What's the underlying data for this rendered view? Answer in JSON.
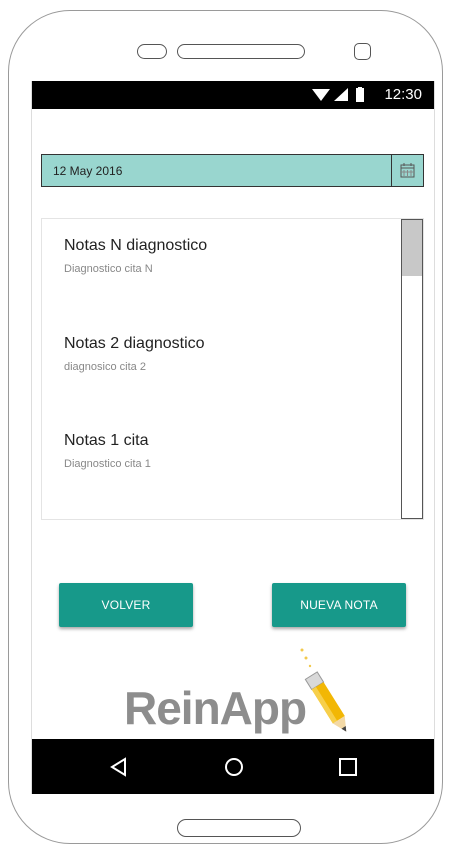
{
  "status_bar": {
    "time": "12:30",
    "icons": [
      "wifi-icon",
      "signal-icon",
      "battery-icon"
    ]
  },
  "date_picker": {
    "value": "12 May 2016",
    "icon": "calendar-icon"
  },
  "notes": [
    {
      "title": "Notas N diagnostico",
      "subtitle": "Diagnostico cita N"
    },
    {
      "title": "Notas 2 diagnostico",
      "subtitle": "diagnosico cita 2"
    },
    {
      "title": "Notas 1 cita",
      "subtitle": "Diagnostico cita 1"
    }
  ],
  "buttons": {
    "back_label": "VOLVER",
    "new_note_label": "NUEVA NOTA"
  },
  "brand": {
    "name": "ReinApp",
    "icon": "pencil-icon"
  },
  "nav_bar": {
    "icons": [
      "back-triangle-icon",
      "home-circle-icon",
      "recents-square-icon"
    ]
  },
  "colors": {
    "accent": "#17998a",
    "date_field_bg": "#99d6cf",
    "brand_gray": "#8d8d8d"
  }
}
